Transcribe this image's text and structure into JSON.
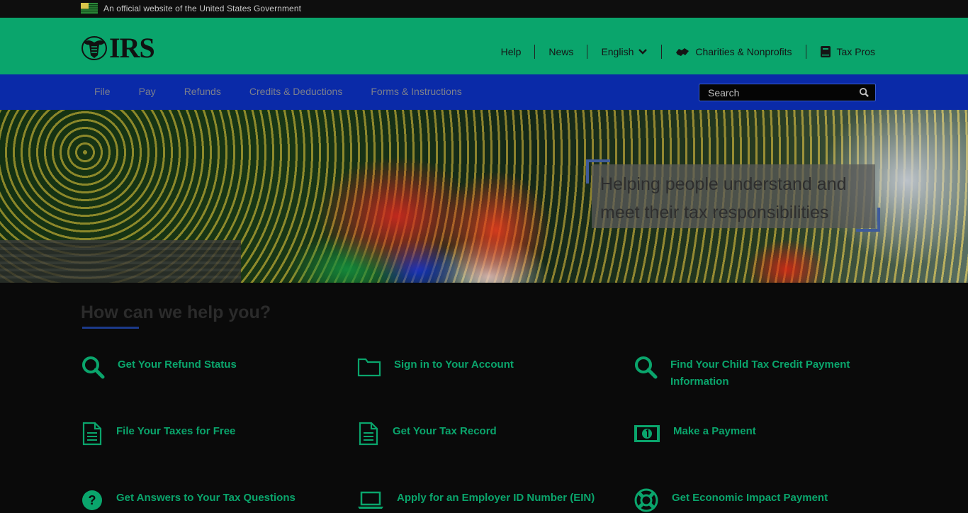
{
  "gov_banner": {
    "text": "An official website of the United States Government",
    "flag_icon": "us-flag-icon"
  },
  "header": {
    "logo_text": "IRS",
    "logo_icon": "irs-eagle-icon",
    "utility_nav": [
      {
        "label": "Help",
        "icon": null
      },
      {
        "label": "News",
        "icon": null
      },
      {
        "label": "English",
        "icon": "chevron-down-icon"
      },
      {
        "label": "Charities & Nonprofits",
        "icon": "handshake-icon"
      },
      {
        "label": "Tax Pros",
        "icon": "book-icon"
      }
    ]
  },
  "main_nav": {
    "items": [
      "File",
      "Pay",
      "Refunds",
      "Credits & Deductions",
      "Forms & Instructions"
    ],
    "search_placeholder": "Search"
  },
  "hero": {
    "caption": "Helping people understand and meet their tax responsibilities"
  },
  "help": {
    "title": "How can we help you?",
    "tasks": [
      {
        "label": "Get Your Refund Status",
        "icon": "search-icon"
      },
      {
        "label": "Sign in to Your Account",
        "icon": "folder-icon"
      },
      {
        "label": "Find Your Child Tax Credit Payment Information",
        "icon": "search-icon"
      },
      {
        "label": "File Your Taxes for Free",
        "icon": "document-icon"
      },
      {
        "label": "Get Your Tax Record",
        "icon": "document-icon"
      },
      {
        "label": "Make a Payment",
        "icon": "money-icon"
      },
      {
        "label": "Get Answers to Your Tax Questions",
        "icon": "question-circle-icon"
      },
      {
        "label": "Apply for an Employer ID Number (EIN)",
        "icon": "laptop-icon"
      },
      {
        "label": "Get Economic Impact Payment",
        "icon": "lifebuoy-icon"
      }
    ]
  },
  "colors": {
    "header_bg": "#0aa56c",
    "nav_bg": "#0a2aa8",
    "link_green": "#0aa56c",
    "page_bg": "#0a0a0a"
  }
}
